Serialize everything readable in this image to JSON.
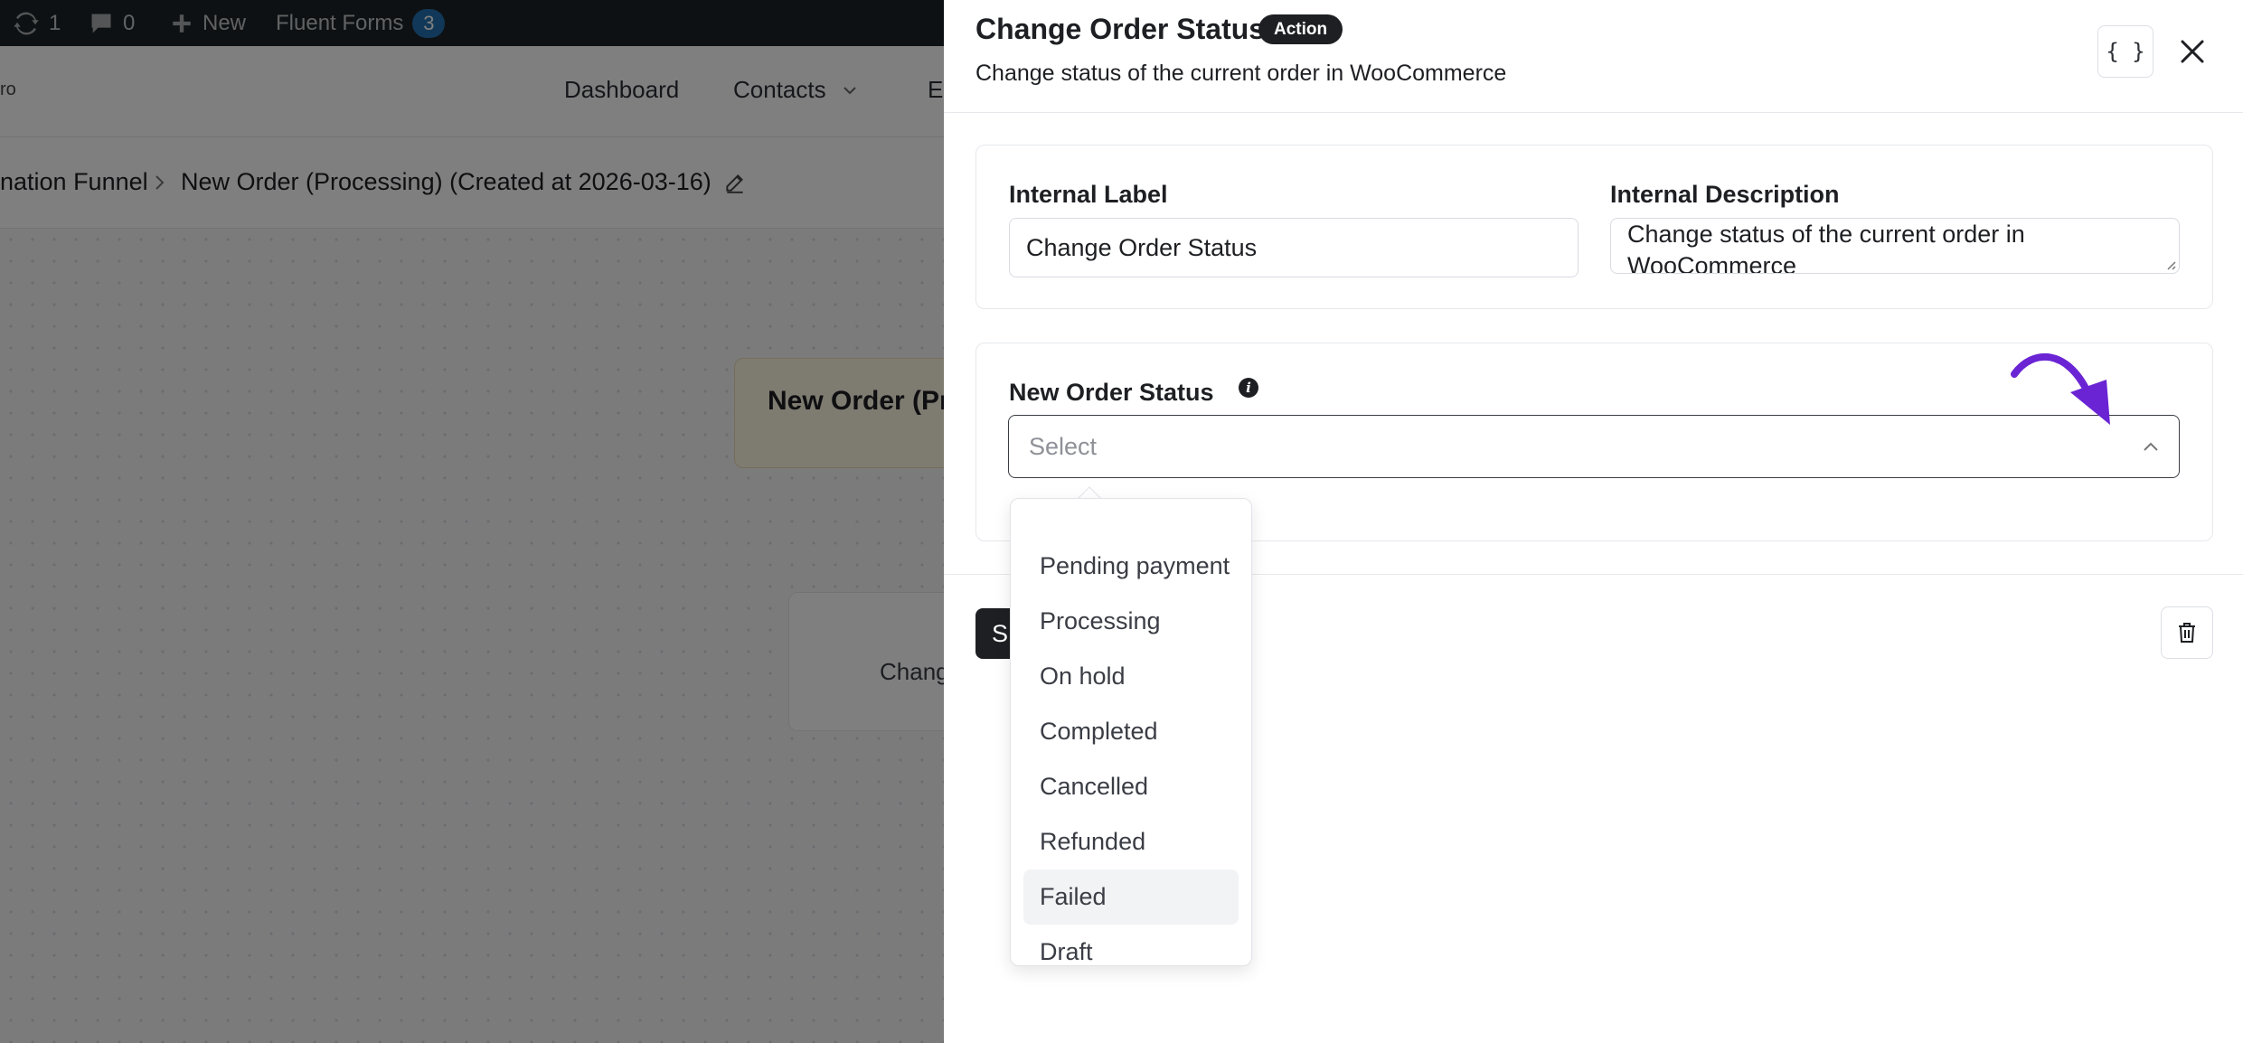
{
  "admin_bar": {
    "updates_count": "1",
    "comments_count": "0",
    "new_label": "New",
    "fluent_forms_label": "Fluent Forms",
    "fluent_forms_badge": "3"
  },
  "top_nav": {
    "brand_fragment": "ro",
    "items": [
      "Dashboard",
      "Contacts",
      "E"
    ]
  },
  "breadcrumb": {
    "parent": "nation Funnel",
    "current": "New Order (Processing) (Created at 2026-03-16)"
  },
  "canvas": {
    "trigger_title": "New Order (Pr",
    "action_text": "Chang"
  },
  "drawer": {
    "title": "Change Order Status",
    "badge": "Action",
    "subtitle": "Change status of the current order in WooCommerce",
    "code_button": "{ }",
    "internal_label": {
      "label": "Internal Label",
      "value": "Change Order Status"
    },
    "internal_description": {
      "label": "Internal Description",
      "value": "Change status of the current order in WooCommerce"
    },
    "new_order_status": {
      "label": "New Order Status",
      "placeholder": "Select",
      "info_icon": "i",
      "options": [
        "Pending payment",
        "Processing",
        "On hold",
        "Completed",
        "Cancelled",
        "Refunded",
        "Failed",
        "Draft"
      ],
      "hovered_option": "Failed"
    },
    "save_button_fragment": "S"
  },
  "colors": {
    "annotation_arrow": "#6a24d4",
    "dark": "#1e1f23",
    "admin_bar": "#1d2327",
    "badge_blue": "#2271b1"
  }
}
